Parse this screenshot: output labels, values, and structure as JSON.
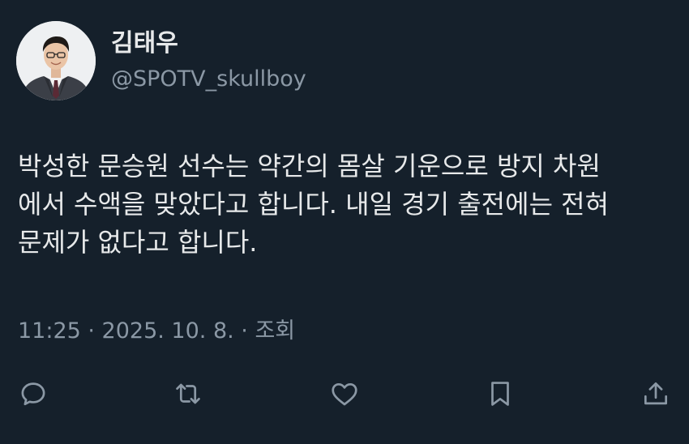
{
  "tweet": {
    "author": {
      "display_name": "김태우",
      "handle": "@SPOTV_skullboy"
    },
    "text_lines": [
      "박성한 문승원 선수는 약간의 몸살 기운으로 방지 차원",
      "에서 수액을 맞았다고 합니다. 내일 경기 출전에는 전혀",
      "문제가 없다고 합니다."
    ],
    "meta": "11:25 · 2025. 10. 8. · 조회"
  },
  "actions": {
    "reply_icon": "reply-icon",
    "retweet_icon": "retweet-icon",
    "like_icon": "heart-icon",
    "bookmark_icon": "bookmark-icon",
    "share_icon": "share-icon"
  },
  "colors": {
    "background": "#15202b",
    "text_primary": "#e7e9ea",
    "text_secondary": "#8b98a5"
  }
}
